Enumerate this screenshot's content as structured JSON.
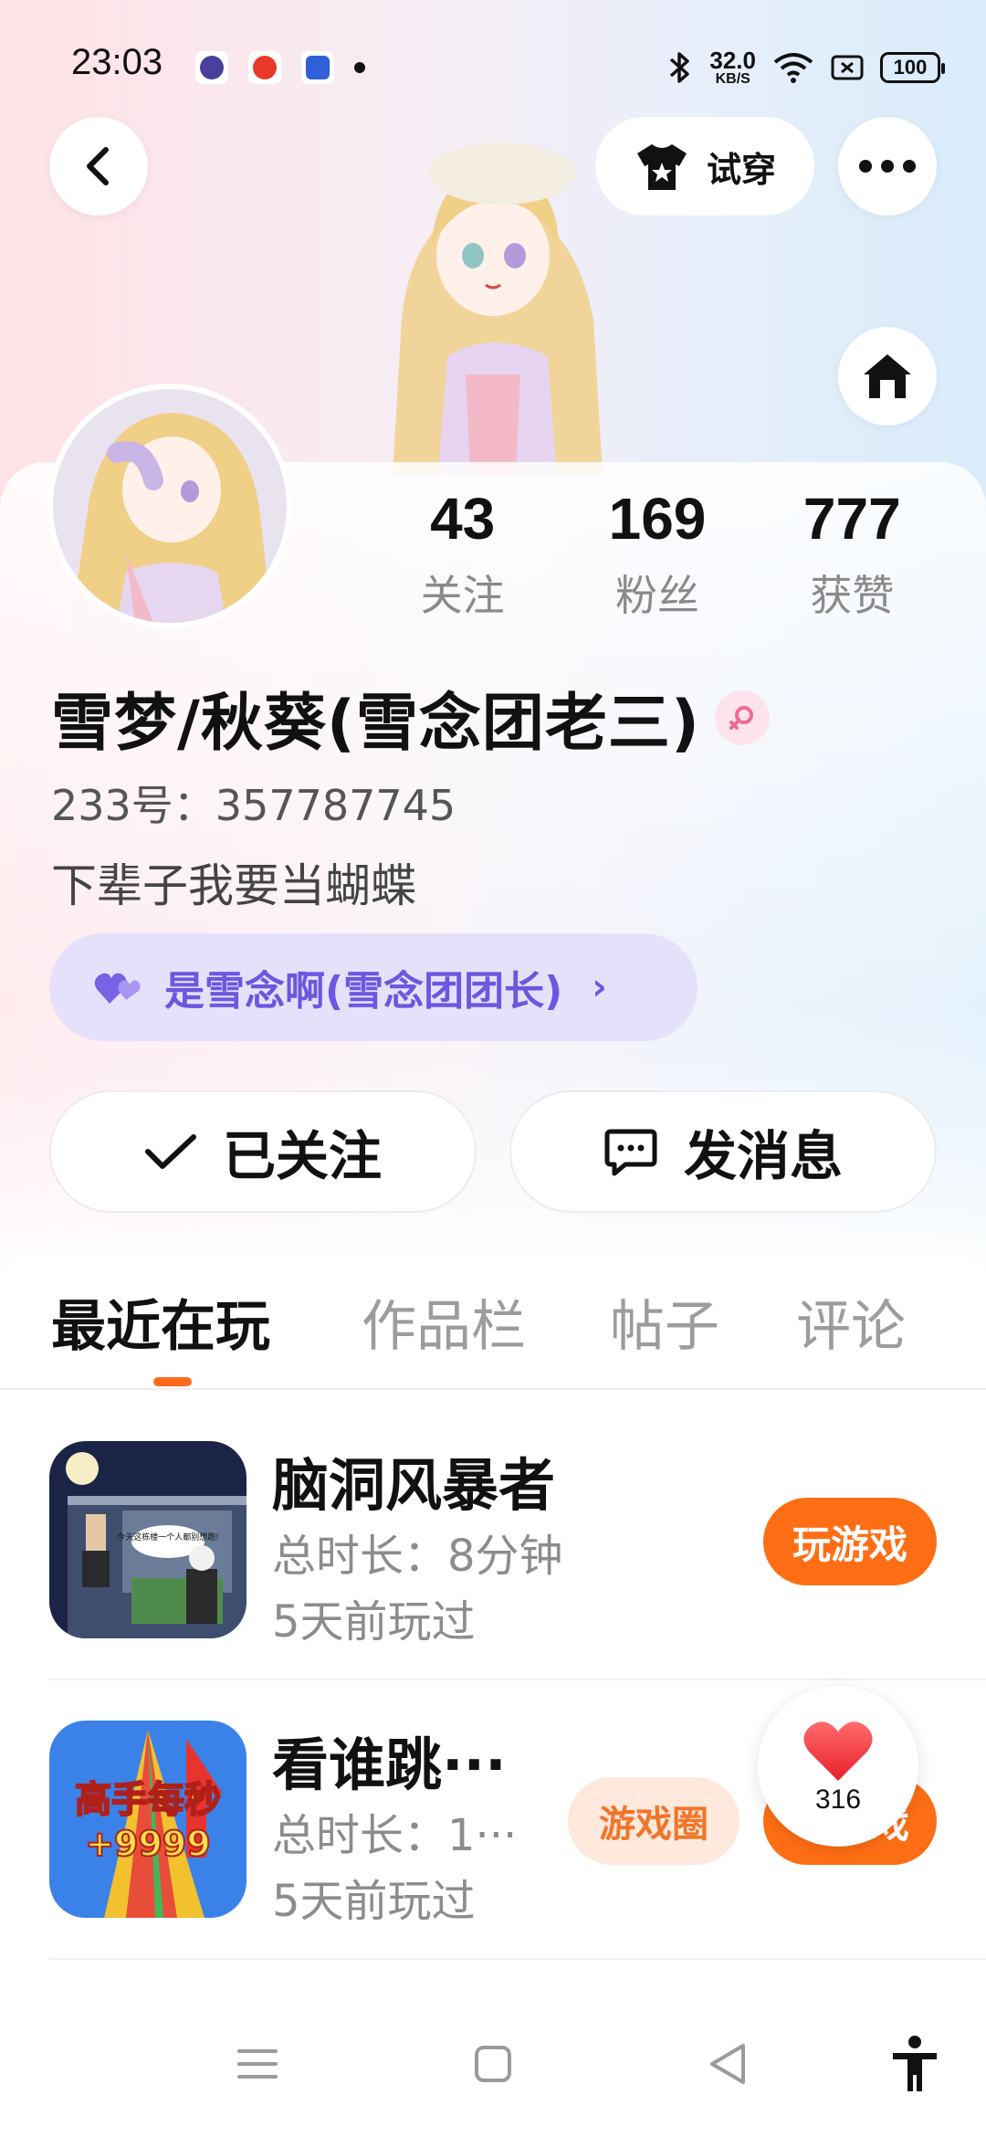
{
  "status_bar": {
    "time": "23:03",
    "net_speed_value": "32.0",
    "net_speed_unit": "KB/S",
    "battery": "100",
    "icons": [
      "bluetooth-icon",
      "wifi-icon",
      "sim-icon",
      "battery-icon"
    ]
  },
  "header": {
    "back_icon": "chevron-left-icon",
    "tryon_label": "试穿",
    "more_icon": "more-horizontal-icon",
    "home_icon": "home-icon"
  },
  "profile": {
    "stats": [
      {
        "value": "43",
        "label": "关注"
      },
      {
        "value": "169",
        "label": "粉丝"
      },
      {
        "value": "777",
        "label": "获赞"
      }
    ],
    "nickname": "雪梦/秋葵(雪念团老三)",
    "gender": "female",
    "uid": "233号：357787745",
    "bio": "下辈子我要当蝴蝶",
    "group": "是雪念啊(雪念团团长)",
    "group_chevron": "›"
  },
  "actions": {
    "follow_label": "已关注",
    "message_label": "发消息"
  },
  "tabs": [
    {
      "label": "最近在玩",
      "active": true
    },
    {
      "label": "作品栏",
      "active": false
    },
    {
      "label": "帖子",
      "active": false
    },
    {
      "label": "评论",
      "active": false
    }
  ],
  "games": [
    {
      "title": "脑洞风暴者",
      "duration": "总时长：8分钟",
      "last_played": "5天前玩过",
      "play_label": "玩游戏",
      "icon_caption": "今天这栋楼一个人都别想跑!"
    },
    {
      "title": "看谁跳···",
      "duration": "总时长：1···",
      "last_played": "5天前玩过",
      "circle_label": "游戏圈",
      "play_label": "戏",
      "icon_text_1": "高手每秒",
      "icon_text_2": "+9999"
    }
  ],
  "like": {
    "count": "316"
  },
  "colors": {
    "accent": "#ff6e14",
    "group_pill_bg": "#e6e1fb",
    "group_pill_text": "#6b57e0"
  }
}
